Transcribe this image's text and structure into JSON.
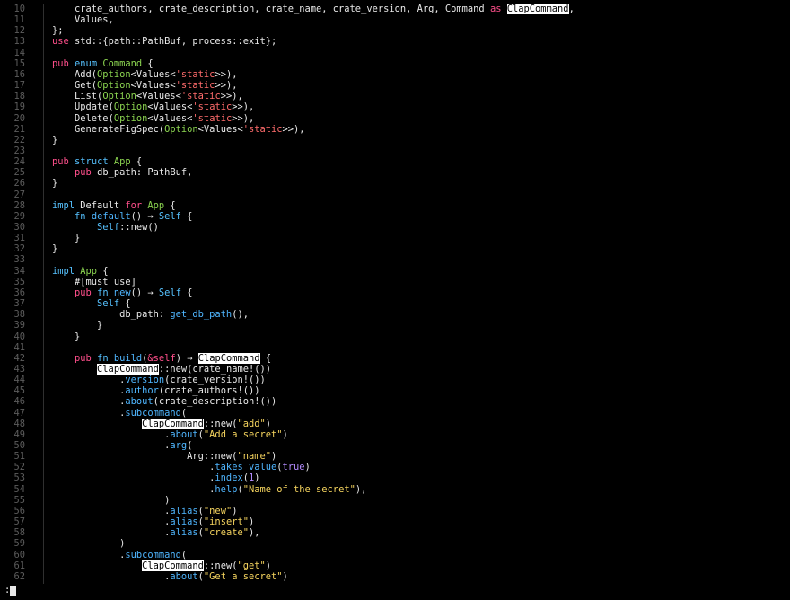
{
  "editor": {
    "highlight_term": "ClapCommand",
    "lines": [
      {
        "n": "10",
        "segs": [
          [
            "p",
            "    crate_authors, crate_description, crate_name, crate_version, Arg, Command "
          ],
          [
            "kw",
            "as"
          ],
          [
            "p",
            " "
          ],
          [
            "hl",
            "ClapCommand"
          ],
          [
            "p",
            ","
          ]
        ]
      },
      {
        "n": "11",
        "segs": [
          [
            "p",
            "    Values,"
          ]
        ]
      },
      {
        "n": "12",
        "segs": [
          [
            "p",
            "};"
          ]
        ]
      },
      {
        "n": "13",
        "segs": [
          [
            "kw",
            "use"
          ],
          [
            "p",
            " std::{path::PathBuf, process::exit};"
          ]
        ]
      },
      {
        "n": "14",
        "segs": []
      },
      {
        "n": "15",
        "segs": [
          [
            "kw",
            "pub"
          ],
          [
            "p",
            " "
          ],
          [
            "kw2",
            "enum"
          ],
          [
            "p",
            " "
          ],
          [
            "ty",
            "Command"
          ],
          [
            "p",
            " {"
          ]
        ]
      },
      {
        "n": "16",
        "segs": [
          [
            "p",
            "    Add("
          ],
          [
            "ty",
            "Option"
          ],
          [
            "p",
            "<Values<"
          ],
          [
            "lt",
            "'static"
          ],
          [
            "p",
            ">>),"
          ]
        ]
      },
      {
        "n": "17",
        "segs": [
          [
            "p",
            "    Get("
          ],
          [
            "ty",
            "Option"
          ],
          [
            "p",
            "<Values<"
          ],
          [
            "lt",
            "'static"
          ],
          [
            "p",
            ">>),"
          ]
        ]
      },
      {
        "n": "18",
        "segs": [
          [
            "p",
            "    List("
          ],
          [
            "ty",
            "Option"
          ],
          [
            "p",
            "<Values<"
          ],
          [
            "lt",
            "'static"
          ],
          [
            "p",
            ">>),"
          ]
        ]
      },
      {
        "n": "19",
        "segs": [
          [
            "p",
            "    Update("
          ],
          [
            "ty",
            "Option"
          ],
          [
            "p",
            "<Values<"
          ],
          [
            "lt",
            "'static"
          ],
          [
            "p",
            ">>),"
          ]
        ]
      },
      {
        "n": "20",
        "segs": [
          [
            "p",
            "    Delete("
          ],
          [
            "ty",
            "Option"
          ],
          [
            "p",
            "<Values<"
          ],
          [
            "lt",
            "'static"
          ],
          [
            "p",
            ">>),"
          ]
        ]
      },
      {
        "n": "21",
        "segs": [
          [
            "p",
            "    GenerateFigSpec("
          ],
          [
            "ty",
            "Option"
          ],
          [
            "p",
            "<Values<"
          ],
          [
            "lt",
            "'static"
          ],
          [
            "p",
            ">>),"
          ]
        ]
      },
      {
        "n": "22",
        "segs": [
          [
            "p",
            "}"
          ]
        ]
      },
      {
        "n": "23",
        "segs": []
      },
      {
        "n": "24",
        "segs": [
          [
            "kw",
            "pub"
          ],
          [
            "p",
            " "
          ],
          [
            "kw2",
            "struct"
          ],
          [
            "p",
            " "
          ],
          [
            "ty",
            "App"
          ],
          [
            "p",
            " {"
          ]
        ]
      },
      {
        "n": "25",
        "segs": [
          [
            "p",
            "    "
          ],
          [
            "kw",
            "pub"
          ],
          [
            "p",
            " db_path: PathBuf,"
          ]
        ]
      },
      {
        "n": "26",
        "segs": [
          [
            "p",
            "}"
          ]
        ]
      },
      {
        "n": "27",
        "segs": []
      },
      {
        "n": "28",
        "segs": [
          [
            "kw2",
            "impl"
          ],
          [
            "p",
            " Default "
          ],
          [
            "kw",
            "for"
          ],
          [
            "p",
            " "
          ],
          [
            "ty",
            "App"
          ],
          [
            "p",
            " {"
          ]
        ]
      },
      {
        "n": "29",
        "segs": [
          [
            "p",
            "    "
          ],
          [
            "kw2",
            "fn"
          ],
          [
            "p",
            " "
          ],
          [
            "fn",
            "default"
          ],
          [
            "p",
            "() → "
          ],
          [
            "kw2",
            "Self"
          ],
          [
            "p",
            " {"
          ]
        ]
      },
      {
        "n": "30",
        "segs": [
          [
            "p",
            "        "
          ],
          [
            "kw2",
            "Self"
          ],
          [
            "p",
            "::new()"
          ]
        ]
      },
      {
        "n": "31",
        "segs": [
          [
            "p",
            "    }"
          ]
        ]
      },
      {
        "n": "32",
        "segs": [
          [
            "p",
            "}"
          ]
        ]
      },
      {
        "n": "33",
        "segs": []
      },
      {
        "n": "34",
        "segs": [
          [
            "kw2",
            "impl"
          ],
          [
            "p",
            " "
          ],
          [
            "ty",
            "App"
          ],
          [
            "p",
            " {"
          ]
        ]
      },
      {
        "n": "35",
        "segs": [
          [
            "p",
            "    #[must_use]"
          ]
        ]
      },
      {
        "n": "36",
        "segs": [
          [
            "p",
            "    "
          ],
          [
            "kw",
            "pub"
          ],
          [
            "p",
            " "
          ],
          [
            "kw2",
            "fn"
          ],
          [
            "p",
            " "
          ],
          [
            "fn",
            "new"
          ],
          [
            "p",
            "() → "
          ],
          [
            "kw2",
            "Self"
          ],
          [
            "p",
            " {"
          ]
        ]
      },
      {
        "n": "37",
        "segs": [
          [
            "p",
            "        "
          ],
          [
            "kw2",
            "Self"
          ],
          [
            "p",
            " {"
          ]
        ]
      },
      {
        "n": "38",
        "segs": [
          [
            "p",
            "            db_path: "
          ],
          [
            "fn",
            "get_db_path"
          ],
          [
            "p",
            "(),"
          ]
        ]
      },
      {
        "n": "39",
        "segs": [
          [
            "p",
            "        }"
          ]
        ]
      },
      {
        "n": "40",
        "segs": [
          [
            "p",
            "    }"
          ]
        ]
      },
      {
        "n": "41",
        "segs": []
      },
      {
        "n": "42",
        "segs": [
          [
            "p",
            "    "
          ],
          [
            "kw",
            "pub"
          ],
          [
            "p",
            " "
          ],
          [
            "kw2",
            "fn"
          ],
          [
            "p",
            " "
          ],
          [
            "fn",
            "build"
          ],
          [
            "p",
            "("
          ],
          [
            "kw",
            "&"
          ],
          [
            "kw",
            "self"
          ],
          [
            "p",
            ") → "
          ],
          [
            "hl",
            "ClapCommand"
          ],
          [
            "p",
            " {"
          ]
        ]
      },
      {
        "n": "43",
        "segs": [
          [
            "p",
            "        "
          ],
          [
            "hl",
            "ClapCommand"
          ],
          [
            "p",
            "::new(crate_name!())"
          ]
        ]
      },
      {
        "n": "44",
        "segs": [
          [
            "p",
            "            ."
          ],
          [
            "fn",
            "version"
          ],
          [
            "p",
            "(crate_version!())"
          ]
        ]
      },
      {
        "n": "45",
        "segs": [
          [
            "p",
            "            ."
          ],
          [
            "fn",
            "author"
          ],
          [
            "p",
            "(crate_authors!())"
          ]
        ]
      },
      {
        "n": "46",
        "segs": [
          [
            "p",
            "            ."
          ],
          [
            "fn",
            "about"
          ],
          [
            "p",
            "(crate_description!())"
          ]
        ]
      },
      {
        "n": "47",
        "segs": [
          [
            "p",
            "            ."
          ],
          [
            "fn",
            "subcommand"
          ],
          [
            "p",
            "("
          ]
        ]
      },
      {
        "n": "48",
        "segs": [
          [
            "p",
            "                "
          ],
          [
            "hl",
            "ClapCommand"
          ],
          [
            "p",
            "::new("
          ],
          [
            "str",
            "\"add\""
          ],
          [
            "p",
            ")"
          ]
        ]
      },
      {
        "n": "49",
        "segs": [
          [
            "p",
            "                    ."
          ],
          [
            "fn",
            "about"
          ],
          [
            "p",
            "("
          ],
          [
            "str",
            "\"Add a secret\""
          ],
          [
            "p",
            ")"
          ]
        ]
      },
      {
        "n": "50",
        "segs": [
          [
            "p",
            "                    ."
          ],
          [
            "fn",
            "arg"
          ],
          [
            "p",
            "("
          ]
        ]
      },
      {
        "n": "51",
        "segs": [
          [
            "p",
            "                        Arg::new("
          ],
          [
            "str",
            "\"name\""
          ],
          [
            "p",
            ")"
          ]
        ]
      },
      {
        "n": "52",
        "segs": [
          [
            "p",
            "                            ."
          ],
          [
            "fn",
            "takes_value"
          ],
          [
            "p",
            "("
          ],
          [
            "num",
            "true"
          ],
          [
            "p",
            ")"
          ]
        ]
      },
      {
        "n": "53",
        "segs": [
          [
            "p",
            "                            ."
          ],
          [
            "fn",
            "index"
          ],
          [
            "p",
            "("
          ],
          [
            "num",
            "1"
          ],
          [
            "p",
            ")"
          ]
        ]
      },
      {
        "n": "54",
        "segs": [
          [
            "p",
            "                            ."
          ],
          [
            "fn",
            "help"
          ],
          [
            "p",
            "("
          ],
          [
            "str",
            "\"Name of the secret\""
          ],
          [
            "p",
            "),"
          ]
        ]
      },
      {
        "n": "55",
        "segs": [
          [
            "p",
            "                    )"
          ]
        ]
      },
      {
        "n": "56",
        "segs": [
          [
            "p",
            "                    ."
          ],
          [
            "fn",
            "alias"
          ],
          [
            "p",
            "("
          ],
          [
            "str",
            "\"new\""
          ],
          [
            "p",
            ")"
          ]
        ]
      },
      {
        "n": "57",
        "segs": [
          [
            "p",
            "                    ."
          ],
          [
            "fn",
            "alias"
          ],
          [
            "p",
            "("
          ],
          [
            "str",
            "\"insert\""
          ],
          [
            "p",
            ")"
          ]
        ]
      },
      {
        "n": "58",
        "segs": [
          [
            "p",
            "                    ."
          ],
          [
            "fn",
            "alias"
          ],
          [
            "p",
            "("
          ],
          [
            "str",
            "\"create\""
          ],
          [
            "p",
            "),"
          ]
        ]
      },
      {
        "n": "59",
        "segs": [
          [
            "p",
            "            )"
          ]
        ]
      },
      {
        "n": "60",
        "segs": [
          [
            "p",
            "            ."
          ],
          [
            "fn",
            "subcommand"
          ],
          [
            "p",
            "("
          ]
        ]
      },
      {
        "n": "61",
        "segs": [
          [
            "p",
            "                "
          ],
          [
            "hl",
            "ClapCommand"
          ],
          [
            "p",
            "::new("
          ],
          [
            "str",
            "\"get\""
          ],
          [
            "p",
            ")"
          ]
        ]
      },
      {
        "n": "62",
        "segs": [
          [
            "p",
            "                    ."
          ],
          [
            "fn",
            "about"
          ],
          [
            "p",
            "("
          ],
          [
            "str",
            "\"Get a secret\""
          ],
          [
            "p",
            ")"
          ]
        ]
      }
    ]
  },
  "cmdline": {
    "prompt": ":"
  },
  "colors": {
    "background": "#000000",
    "keyword": "#ff4f8b",
    "keyword_alt": "#56c2ff",
    "type": "#8bd450",
    "function": "#4fb6ff",
    "string": "#f4d35e",
    "lifetime": "#ff6b6b",
    "number": "#b48cff",
    "line_number": "#5c5c5c",
    "search_highlight_bg": "#ffffff"
  }
}
